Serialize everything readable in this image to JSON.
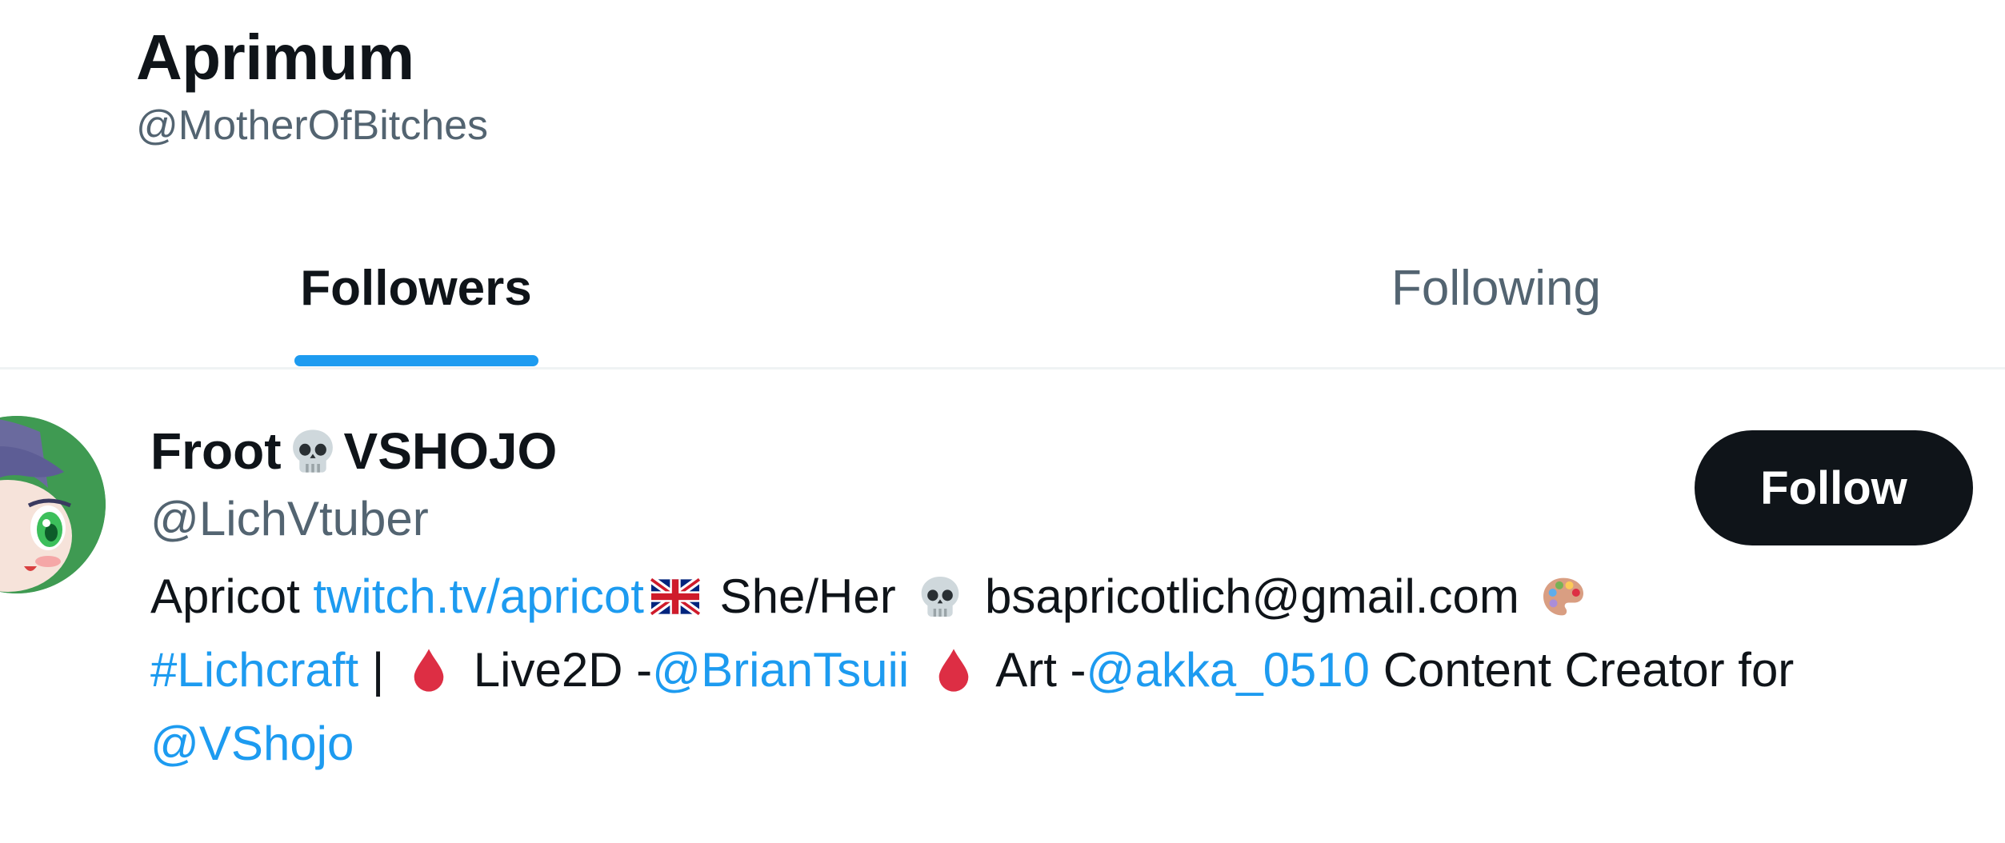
{
  "profile": {
    "name": "Aprimum",
    "handle": "@MotherOfBitches"
  },
  "tabs": [
    {
      "label": "Followers",
      "selected": true
    },
    {
      "label": "Following",
      "selected": false
    }
  ],
  "colors": {
    "accent": "#1d9bf0",
    "text_primary": "#0f1419",
    "text_secondary": "#536471",
    "follow_button_bg": "#0f1419",
    "divider": "#eff3f4"
  },
  "users": [
    {
      "name_part1": "Froot",
      "name_emoji": "skull-icon",
      "name_part2": "VSHOJO",
      "handle": "@LichVtuber",
      "follow_label": "Follow",
      "avatar_icon": "avatar-anime-character",
      "bio": {
        "t1": "Apricot ",
        "link1": "twitch.tv/apricot",
        "t2": " She/Her ",
        "t3": " bsapricotlich@gmail.com ",
        "link2": "#Lichcraft",
        "t4": " | ",
        "t5": " Live2D -",
        "link3": "@BrianTsuii",
        "t6": " Art -",
        "link4": "@akka_0510",
        "t7": " Content Creator for ",
        "link5": "@VShojo",
        "emoji_flag": "uk-flag-icon",
        "emoji_skull": "skull-icon",
        "emoji_palette": "palette-icon",
        "emoji_drop": "blood-drop-icon"
      }
    }
  ]
}
